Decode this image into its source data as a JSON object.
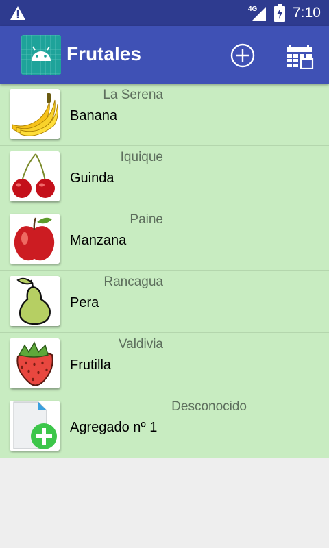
{
  "status_bar": {
    "network": "4G",
    "time": "7:10"
  },
  "app_bar": {
    "title": "Frutales"
  },
  "list": [
    {
      "city": "La Serena",
      "name": "Banana",
      "icon": "banana-icon"
    },
    {
      "city": "Iquique",
      "name": "Guinda",
      "icon": "cherry-icon"
    },
    {
      "city": "Paine",
      "name": "Manzana",
      "icon": "apple-icon"
    },
    {
      "city": "Rancagua",
      "name": "Pera",
      "icon": "pear-icon"
    },
    {
      "city": "Valdivia",
      "name": "Frutilla",
      "icon": "strawberry-icon"
    },
    {
      "city": "Desconocido",
      "name": "Agregado nº 1",
      "icon": "add-file-icon"
    }
  ],
  "colors": {
    "status_bar": "#2e3b8f",
    "app_bar": "#3f51b5",
    "list_background": "#c8ecc1",
    "page_background": "#eeeeee"
  }
}
